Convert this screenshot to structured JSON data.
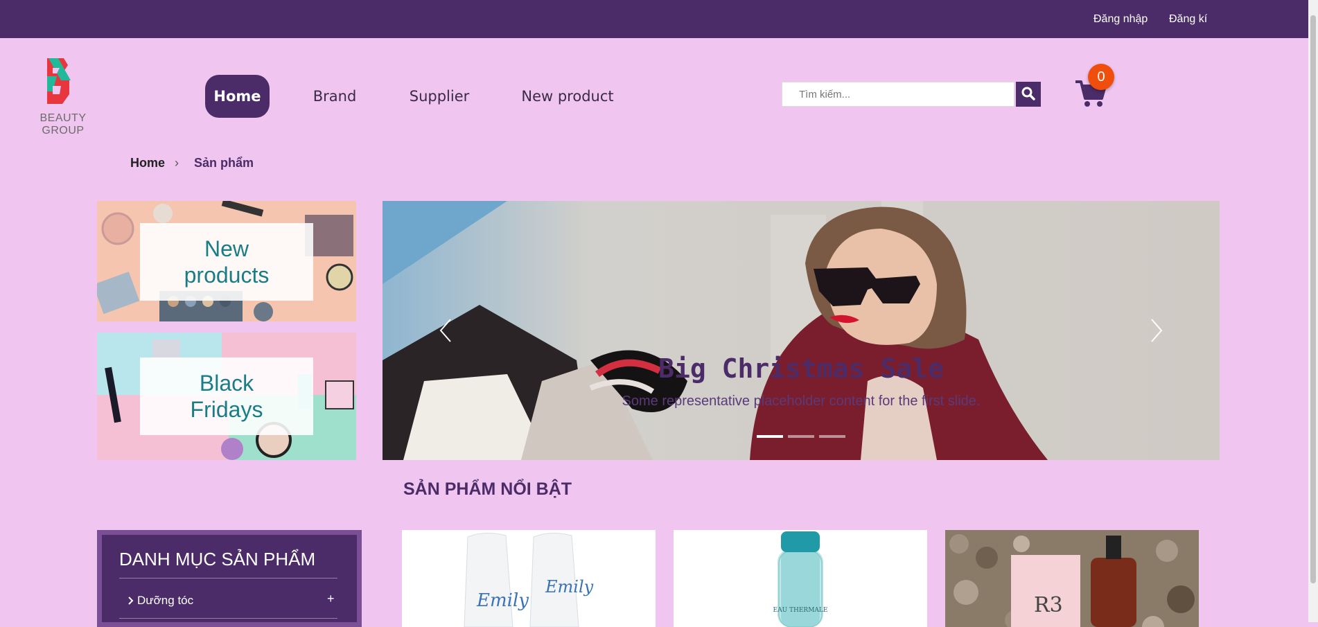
{
  "topbar": {
    "login": "Đăng nhập",
    "register": "Đăng kí"
  },
  "logo": {
    "text": "BEAUTY GROUP"
  },
  "nav": [
    {
      "label": "Home",
      "active": true
    },
    {
      "label": "Brand"
    },
    {
      "label": "Supplier"
    },
    {
      "label": "New product"
    }
  ],
  "search": {
    "placeholder": "Tìm kiếm..."
  },
  "cart": {
    "count": "0"
  },
  "breadcrumb": {
    "home": "Home",
    "separator": "›",
    "current": "Sản phẩm"
  },
  "promos": [
    {
      "label_line1": "New",
      "label_line2": "products"
    },
    {
      "label_line1": "Black",
      "label_line2": "Fridays"
    }
  ],
  "carousel": {
    "title": "Big Christmas Sale",
    "caption": "Some representative placeholder content for the first slide.",
    "slide_count": 3,
    "active_index": 0
  },
  "featured": {
    "title": "SẢN PHẨM NỔI BẬT"
  },
  "sidebar": {
    "title": "DANH MỤC SẢN PHẨM",
    "items": [
      {
        "label": "Dưỡng tóc",
        "toggle": "+"
      }
    ]
  },
  "products": [
    {
      "brand_text": "Emily"
    },
    {
      "brand_text": "EAU THERMALE"
    },
    {
      "brand_text": "R3"
    }
  ],
  "colors": {
    "primary": "#4b2c68",
    "background": "#f0c6f0",
    "accent_badge": "#f04e0c",
    "promo_text": "#1a7d86"
  }
}
